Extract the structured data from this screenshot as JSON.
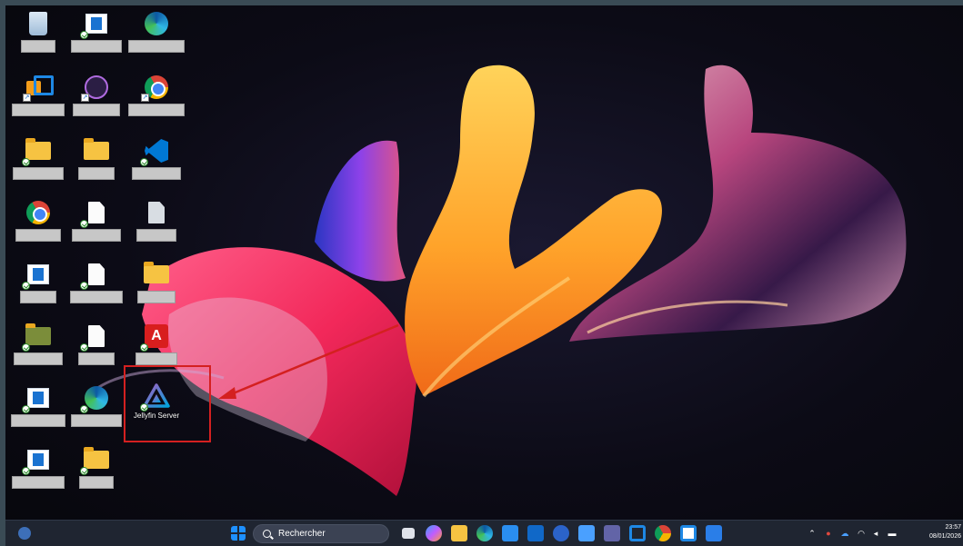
{
  "desktop": {
    "jellyfin_label": "Jellyfin Server",
    "icons": [
      {
        "name": "recycle-bin-icon"
      },
      {
        "name": "windows-app-icon"
      },
      {
        "name": "edge-profile-icon"
      },
      {
        "name": "remote-desktop-icon"
      },
      {
        "name": "obs-icon"
      },
      {
        "name": "chrome-icon"
      },
      {
        "name": "folder-icon"
      },
      {
        "name": "folder-icon"
      },
      {
        "name": "vscode-icon"
      },
      {
        "name": "chrome-icon"
      },
      {
        "name": "document-icon"
      },
      {
        "name": "document-icon"
      },
      {
        "name": "windows-app-icon"
      },
      {
        "name": "document-icon"
      },
      {
        "name": "folder-icon"
      },
      {
        "name": "map-icon"
      },
      {
        "name": "document-icon"
      },
      {
        "name": "adobe-acrobat-icon"
      },
      {
        "name": "windows-app-icon"
      },
      {
        "name": "edge-profile-icon"
      },
      {
        "name": "jellyfin-server-icon"
      },
      {
        "name": "windows-app-icon"
      },
      {
        "name": "folder-icon"
      }
    ]
  },
  "taskbar": {
    "search_label": "Rechercher",
    "pinned": [
      "widgets-icon",
      "start-icon",
      "search-icon",
      "task-view-icon",
      "copilot-icon",
      "file-explorer-icon",
      "edge-icon",
      "store-icon",
      "outlook-icon",
      "database-icon",
      "mail-icon",
      "teams-icon",
      "office-icon",
      "chrome-icon",
      "app-icon",
      "pinned-app-icon"
    ],
    "clock_time": "23:57",
    "clock_date": "08/01/2026"
  },
  "colors": {
    "taskbar_bg": "#222834",
    "highlight_box": "#d42020",
    "arrow": "#d42020"
  }
}
